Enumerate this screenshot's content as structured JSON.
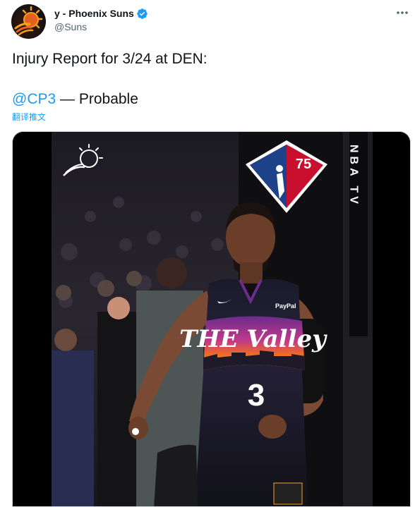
{
  "author": {
    "display_name": "y - Phoenix Suns",
    "handle": "@Suns"
  },
  "tweet": {
    "line1": "Injury Report for 3/24 at DEN:",
    "mention": "@CP3",
    "status_text": " — Probable",
    "translate_label": "翻译推文"
  },
  "media": {
    "jersey_text": "THE Valley",
    "jersey_number": "3",
    "sponsor": "PayPal",
    "logo_number": "75",
    "courtside_text": "NBA TV"
  },
  "colors": {
    "link": "#1d9bf0",
    "verified": "#1d9bf0",
    "secondary_text": "#536471"
  },
  "icons": {
    "avatar": "phoenix-suns-logo",
    "verified": "verified-badge-icon",
    "more": "more-options-icon"
  }
}
